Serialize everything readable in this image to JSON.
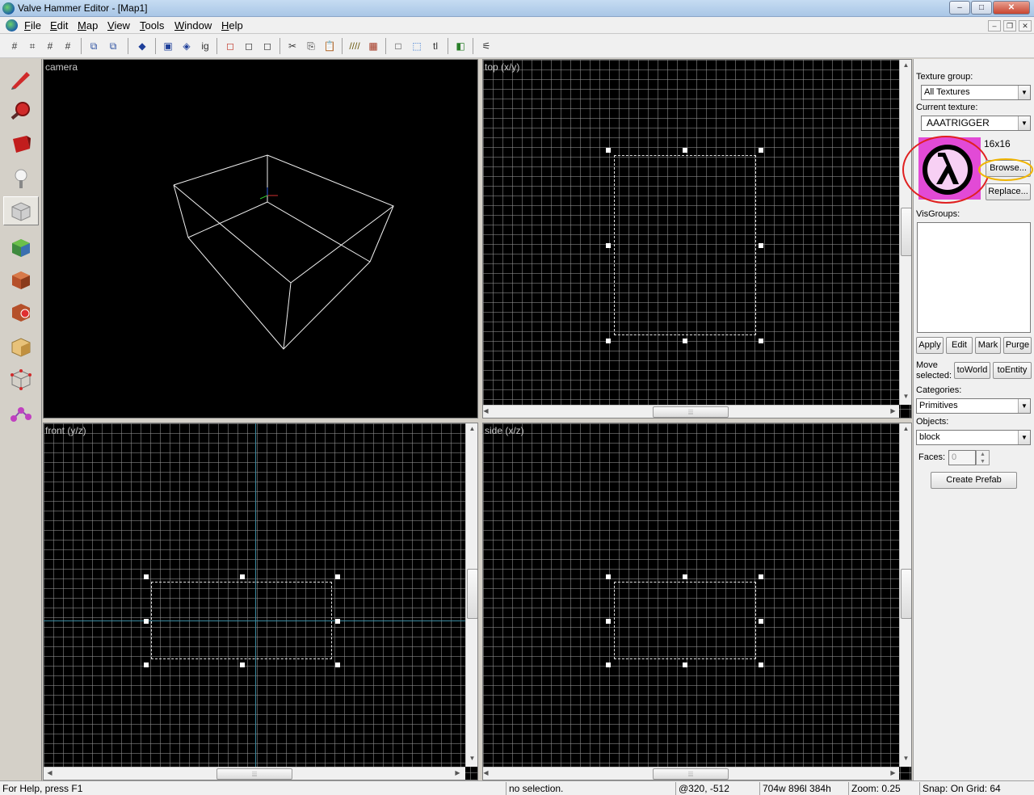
{
  "window": {
    "title": "Valve Hammer Editor - [Map1]",
    "minimize": "–",
    "maximize": "□",
    "close": "✕"
  },
  "menu": {
    "items": [
      "File",
      "Edit",
      "Map",
      "View",
      "Tools",
      "Window",
      "Help"
    ],
    "mdi_minimize": "–",
    "mdi_restore": "❐",
    "mdi_close": "✕"
  },
  "toolbar": {
    "buttons": [
      "grid-toggle-icon",
      "grid-3d-icon",
      "grid-smaller-icon",
      "grid-larger-icon",
      "group-icon",
      "ungroup-icon",
      "carve-icon",
      "hollow-icon",
      "toggle-texlock-icon",
      "ignore-groups-icon",
      "hide-items-icon",
      "show-hidden-icon",
      "edit-visgroups-icon",
      "cut-icon",
      "copy-icon",
      "paste-icon",
      "texture-app-icon",
      "decals-icon",
      "selection-box-icon",
      "select-region-icon",
      "transform-icon",
      "flip-icon",
      "run-map-icon"
    ]
  },
  "tools": [
    "selection-tool-icon",
    "magnify-tool-icon",
    "camera-tool-icon",
    "entity-tool-icon",
    "block-tool-icon",
    "texture-application-icon",
    "apply-texture-icon",
    "decal-tool-icon",
    "clipping-tool-icon",
    "vertex-tool-icon",
    "path-tool-icon"
  ],
  "viewports": {
    "camera": "camera",
    "top": "top (x/y)",
    "front": "front (y/z)",
    "side": "side (x/z)"
  },
  "panel": {
    "texture_group_label": "Texture group:",
    "texture_group_value": "All Textures",
    "current_texture_label": "Current texture:",
    "current_texture_value": "AAATRIGGER",
    "texture_size": "16x16",
    "browse": "Browse...",
    "replace": "Replace...",
    "visgroups_label": "VisGroups:",
    "apply": "Apply",
    "edit": "Edit",
    "mark": "Mark",
    "purge": "Purge",
    "move_label_1": "Move",
    "move_label_2": "selected:",
    "to_world": "toWorld",
    "to_entity": "toEntity",
    "categories_label": "Categories:",
    "categories_value": "Primitives",
    "objects_label": "Objects:",
    "objects_value": "block",
    "faces_label": "Faces:",
    "faces_value": "0",
    "create_prefab": "Create Prefab",
    "annotation_colors": {
      "texture_circle": "#e02020",
      "browse_circle": "#f0b400"
    }
  },
  "status": {
    "help": "For Help, press F1",
    "selection": "no selection.",
    "coords": "@320, -512",
    "size": "704w 896l 384h",
    "zoom": "Zoom: 0.25",
    "snap": "Snap: On Grid: 64"
  }
}
